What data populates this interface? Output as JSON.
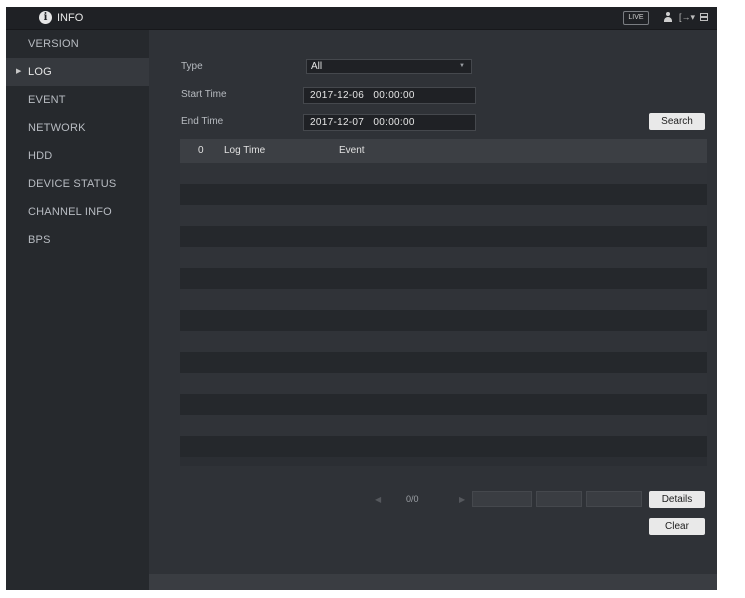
{
  "window": {
    "title": "INFO",
    "live_label": "LIVE"
  },
  "sidebar": {
    "items": [
      {
        "label": "VERSION",
        "active": false
      },
      {
        "label": "LOG",
        "active": true
      },
      {
        "label": "EVENT",
        "active": false
      },
      {
        "label": "NETWORK",
        "active": false
      },
      {
        "label": "HDD",
        "active": false
      },
      {
        "label": "DEVICE STATUS",
        "active": false
      },
      {
        "label": "CHANNEL INFO",
        "active": false
      },
      {
        "label": "BPS",
        "active": false
      }
    ]
  },
  "form": {
    "type_label": "Type",
    "type_value": "All",
    "start_label": "Start Time",
    "start_value": "2017-12-06   00:00:00",
    "end_label": "End Time",
    "end_value": "2017-12-07   00:00:00",
    "search_label": "Search"
  },
  "table": {
    "columns": [
      "0",
      "Log Time",
      "Event"
    ],
    "rows": []
  },
  "pager": {
    "page_info": "0/0"
  },
  "actions": {
    "details_label": "Details",
    "clear_label": "Clear"
  },
  "colors": {
    "background": "#2f3237",
    "sidebar": "#26292d",
    "button": "#e9e9e9"
  },
  "icons": [
    "info-icon",
    "user-icon",
    "exit-icon",
    "grid-icon",
    "chevron-right-icon",
    "dropdown-caret-icon"
  ]
}
